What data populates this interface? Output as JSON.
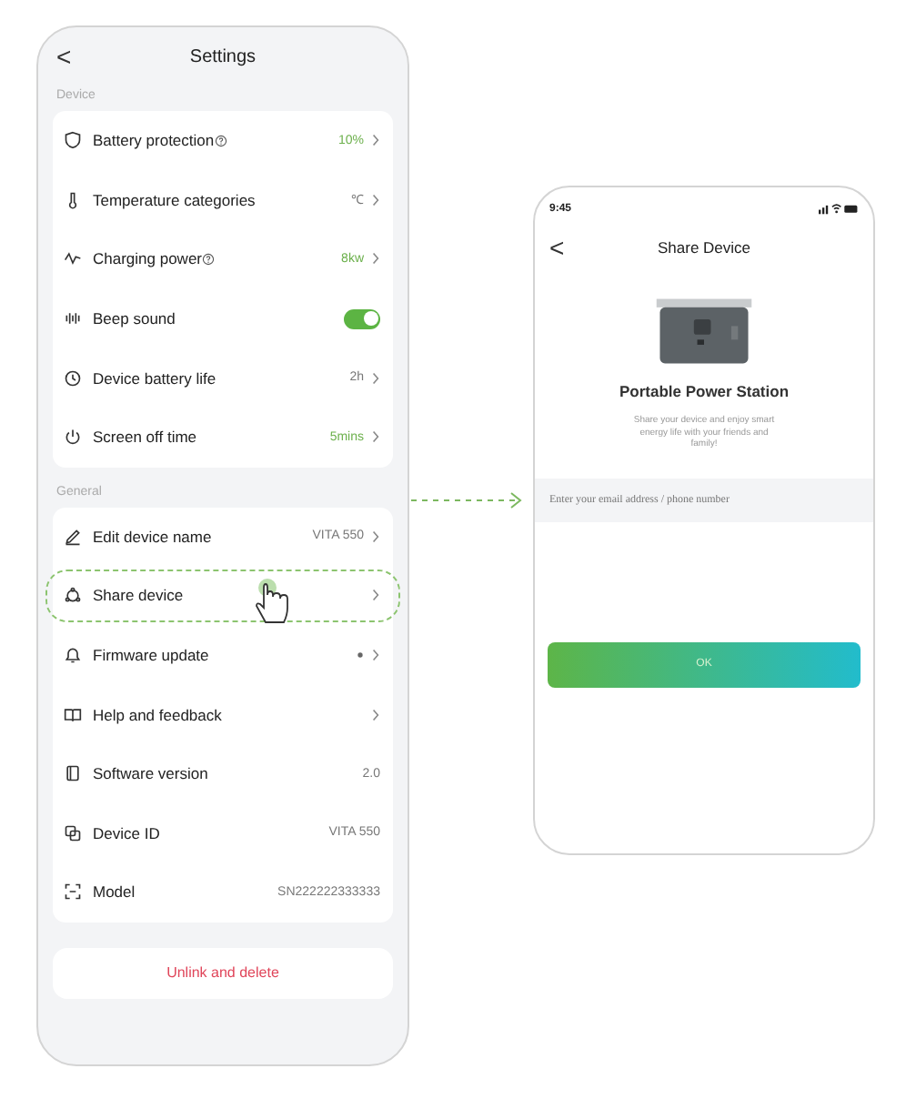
{
  "settings_screen": {
    "title": "Settings",
    "back": "<",
    "sections": [
      {
        "heading": "Device",
        "items": [
          {
            "label": "Battery protection",
            "help": true,
            "kind": "value",
            "value": "10%",
            "highlighted": true
          },
          {
            "label": "Temperature categories",
            "help": false,
            "kind": "value",
            "value": "℃",
            "highlighted": false
          },
          {
            "label": "Charging power",
            "help": true,
            "kind": "value",
            "value": "8kw",
            "highlighted": true
          },
          {
            "label": "Beep sound",
            "help": false,
            "kind": "toggle",
            "on": true
          },
          {
            "label": "Device battery life",
            "help": false,
            "kind": "value",
            "value": "2h",
            "highlighted": false
          },
          {
            "label": "Screen off time",
            "help": false,
            "kind": "value",
            "value": "5mins",
            "highlighted": true
          }
        ]
      },
      {
        "heading": "General",
        "items": [
          {
            "label": "Edit device name",
            "help": false,
            "kind": "value",
            "value": "VITA 550",
            "highlighted": false
          },
          {
            "label": "Share device",
            "help": false,
            "kind": "link",
            "tapped": true
          },
          {
            "label": "Firmware update",
            "help": false,
            "kind": "update"
          },
          {
            "label": "Help and feedback",
            "help": false,
            "kind": "link",
            "tapped": false
          },
          {
            "label": "Software version",
            "help": false,
            "kind": "info",
            "value": "2.0"
          },
          {
            "label": "Device ID",
            "help": false,
            "kind": "info",
            "value": "VITA 550"
          },
          {
            "label": "Model",
            "help": false,
            "kind": "info",
            "value": "SN222222333333"
          }
        ]
      }
    ],
    "danger_button": "Unlink and delete"
  },
  "share_screen": {
    "time": "9:45",
    "back": "<",
    "title": "Share Device",
    "product_name": "Portable Power Station",
    "description": "Share your device and enjoy smart energy life with your friends and family!",
    "email_field": {
      "placeholder": "Enter your email address / phone number"
    },
    "ok_button": "OK"
  }
}
